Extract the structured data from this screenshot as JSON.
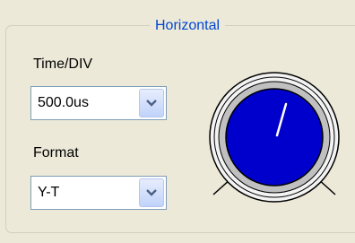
{
  "group": {
    "title": "Horizontal"
  },
  "time_div": {
    "label": "Time/DIV",
    "value": "500.0us"
  },
  "format": {
    "label": "Format",
    "value": "Y-T"
  },
  "icons": {
    "dropdown": "chevron-down-icon"
  },
  "colors": {
    "accent": "#0046d5",
    "knob": "#0000cc"
  }
}
